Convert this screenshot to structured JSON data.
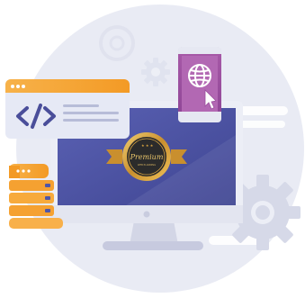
{
  "badge": {
    "script_text": "Premium",
    "small_text": "WEB PLANNING"
  },
  "icons": {
    "code": "code-brackets-icon",
    "globe": "globe-icon",
    "cursor": "cursor-arrow-icon",
    "gear_large": "gear-icon",
    "gear_small": "gear-icon",
    "server": "server-stack-icon",
    "monitor": "desktop-monitor-icon"
  },
  "colors": {
    "circle_bg": "#e7e9f3",
    "screen": "#4f56a8",
    "screen_bezel": "#e6e8f2",
    "monitor_stand": "#d3d6e6",
    "browser_orange": "#f5a623",
    "browser_body": "#e3e6f3",
    "code_symbol": "#4a4e9a",
    "phone": "#9b4f9e",
    "phone_screen": "#b567b5",
    "server_orange": "#f6a23a",
    "gear": "#d8dbe8",
    "badge_gold": "#d9a441",
    "badge_dark": "#2b2b2b"
  }
}
